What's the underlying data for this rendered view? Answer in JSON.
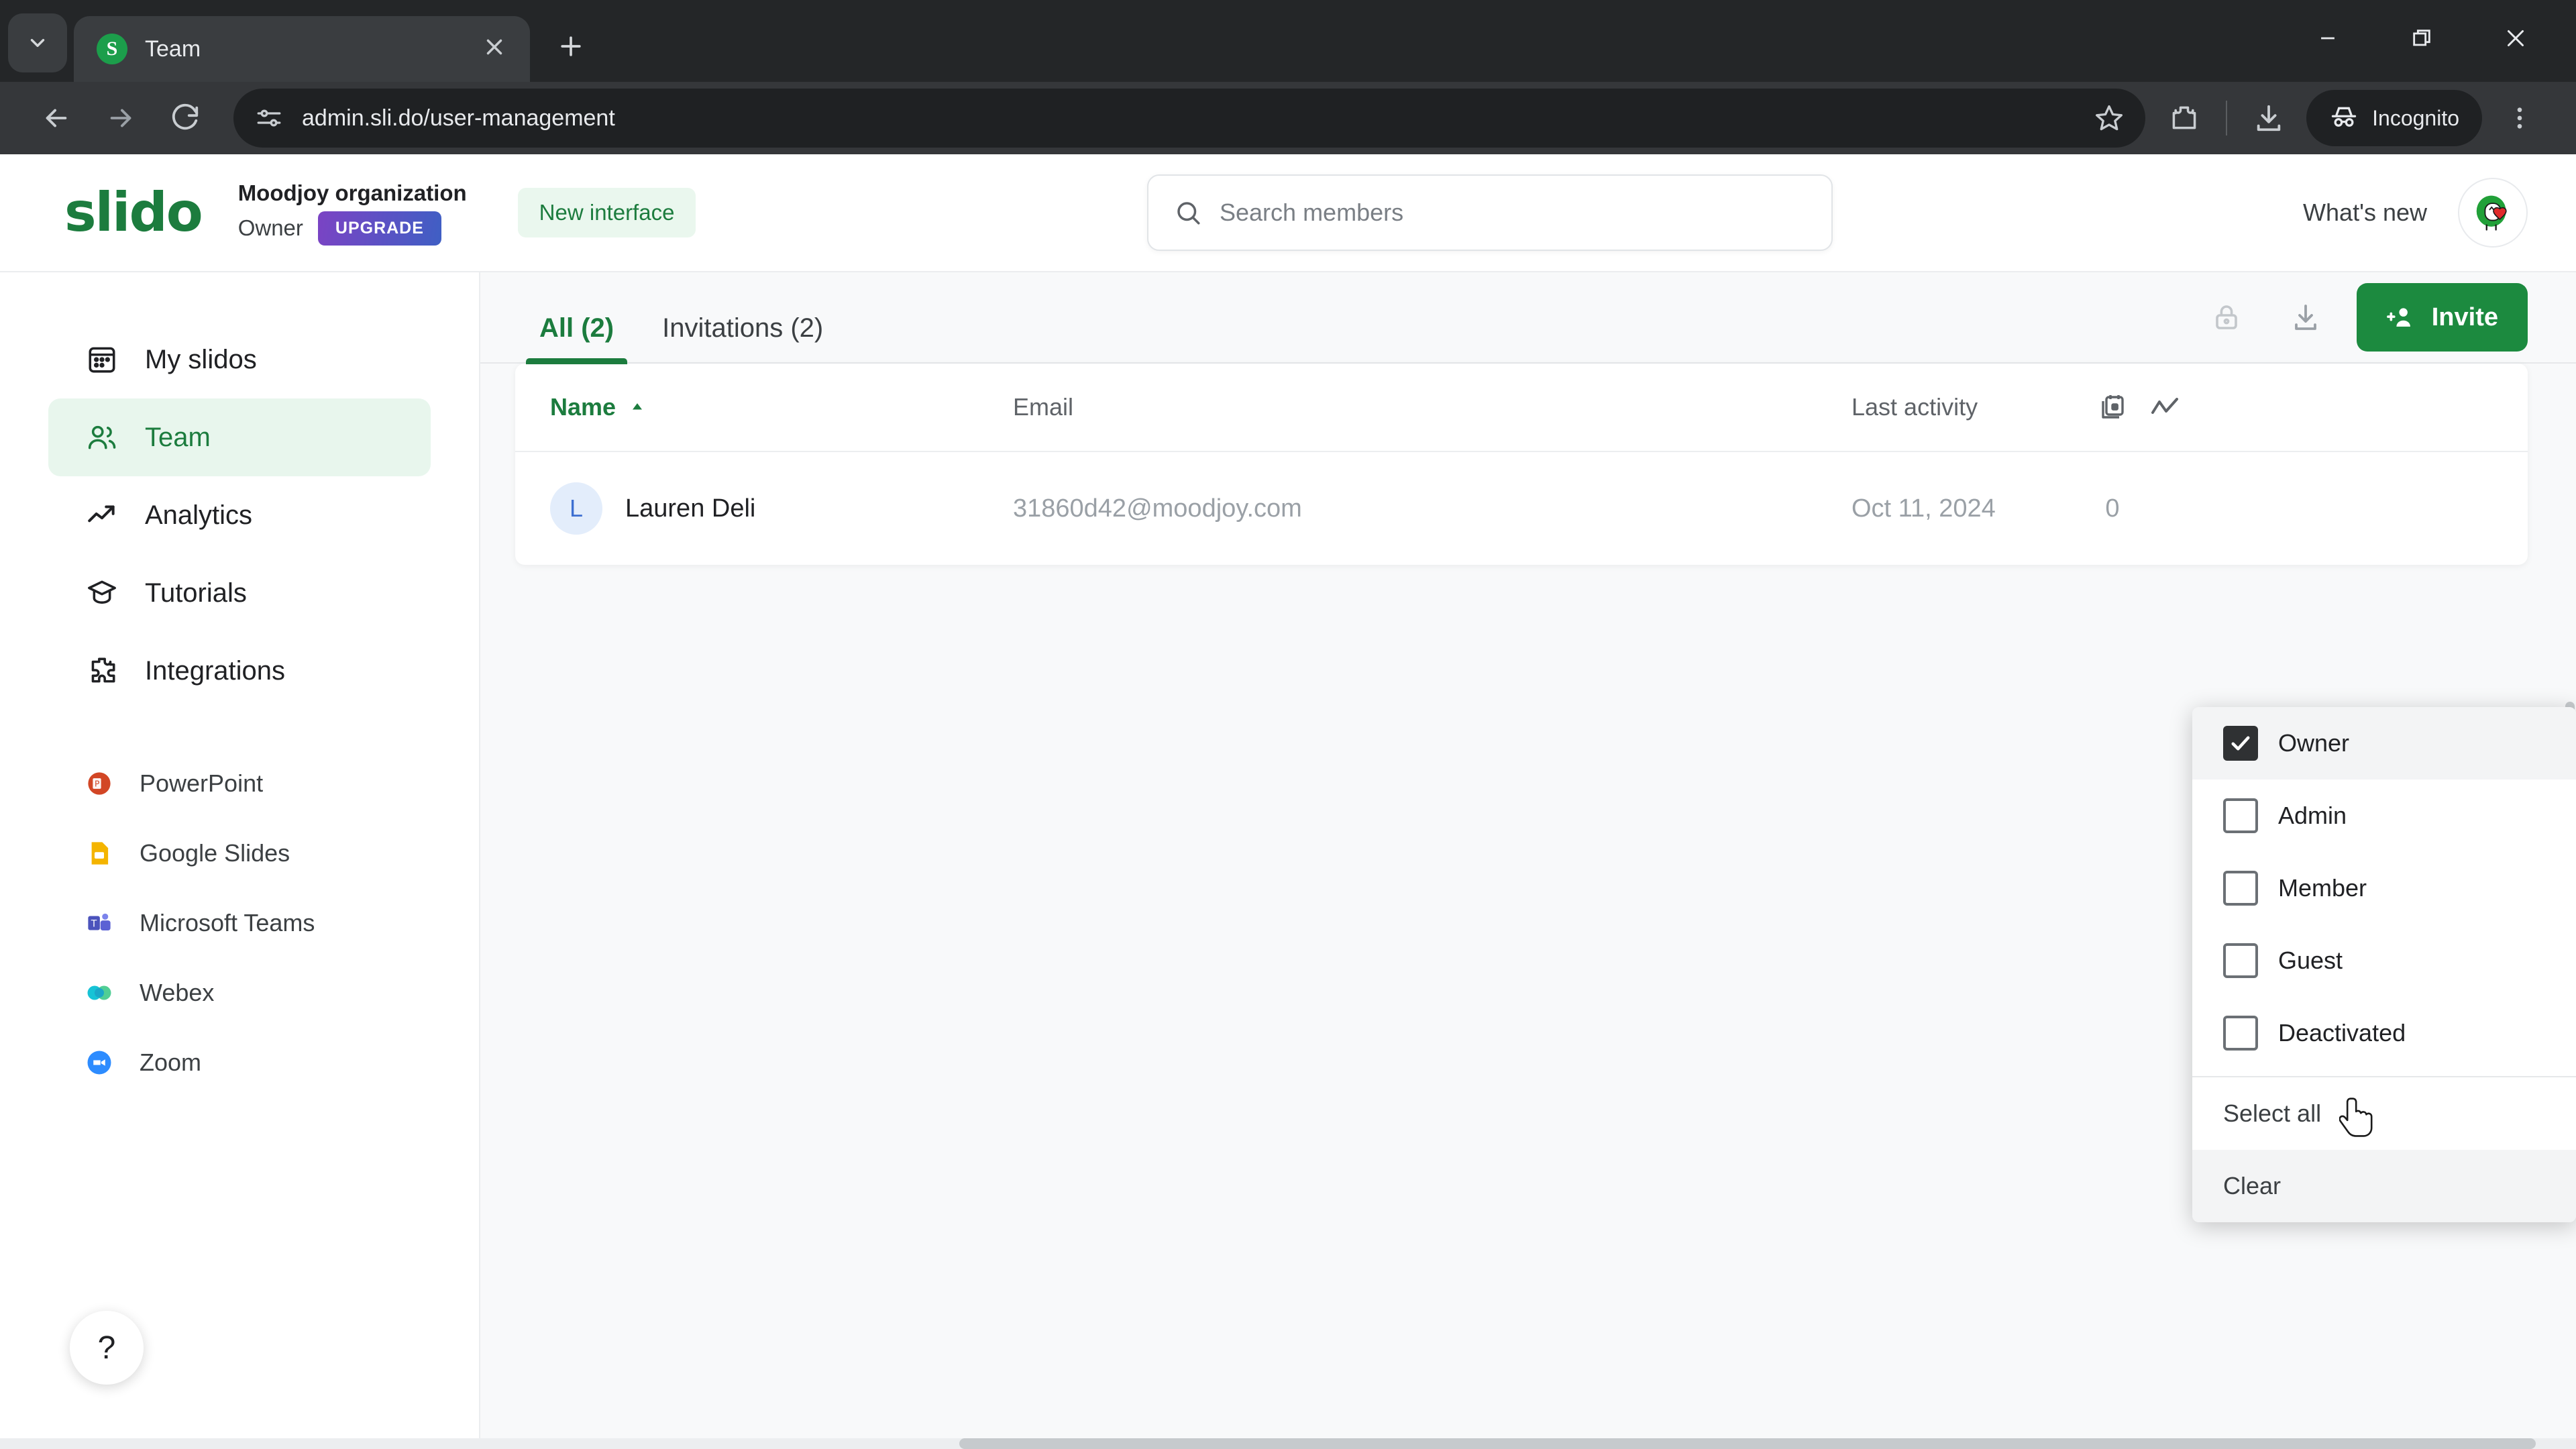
{
  "browser": {
    "tab": {
      "title": "Team",
      "favicon_letter": "S",
      "favicon_icon": "slido-favicon",
      "close_icon": "close-icon"
    },
    "tab_search_icon": "chevron-down-icon",
    "new_tab_icon": "plus-icon",
    "window": {
      "minimize_icon": "minimize-icon",
      "maximize_icon": "maximize-icon",
      "close_icon": "window-close-icon"
    },
    "nav": {
      "back_icon": "back-arrow-icon",
      "forward_icon": "forward-arrow-icon",
      "reload_icon": "reload-icon"
    },
    "omnibox": {
      "site_info_icon": "site-settings-icon",
      "url": "admin.sli.do/user-management",
      "bookmark_icon": "star-icon"
    },
    "actions": {
      "extensions_icon": "extensions-icon",
      "downloads_icon": "download-icon",
      "incognito_label": "Incognito",
      "incognito_icon": "incognito-icon",
      "menu_icon": "three-dot-menu-icon"
    }
  },
  "appheader": {
    "logo": "slido",
    "org_name": "Moodjoy organization",
    "org_role": "Owner",
    "upgrade_label": "UPGRADE",
    "new_interface_label": "New interface",
    "search": {
      "placeholder": "Search members",
      "value": "",
      "icon": "search-icon"
    },
    "whats_new_label": "What's new",
    "avatar_icon": "user-avatar-icon"
  },
  "sidebar": {
    "items": [
      {
        "label": "My slidos",
        "icon": "calendar-icon",
        "active": false
      },
      {
        "label": "Team",
        "icon": "people-icon",
        "active": true
      },
      {
        "label": "Analytics",
        "icon": "trend-up-icon",
        "active": false
      },
      {
        "label": "Tutorials",
        "icon": "graduation-cap-icon",
        "active": false
      },
      {
        "label": "Integrations",
        "icon": "puzzle-piece-icon",
        "active": false
      }
    ],
    "integrations": [
      {
        "label": "PowerPoint",
        "icon": "powerpoint-icon",
        "color": "#d24625"
      },
      {
        "label": "Google Slides",
        "icon": "google-slides-icon",
        "color": "#f4b400"
      },
      {
        "label": "Microsoft Teams",
        "icon": "microsoft-teams-icon",
        "color": "#4b53bc"
      },
      {
        "label": "Webex",
        "icon": "webex-icon",
        "color": "#17a2b8"
      },
      {
        "label": "Zoom",
        "icon": "zoom-icon",
        "color": "#2d8cff"
      }
    ],
    "help_label": "?",
    "help_icon": "help-question-icon"
  },
  "main": {
    "tabs": [
      {
        "label": "All (2)",
        "active": true
      },
      {
        "label": "Invitations (2)",
        "active": false
      }
    ],
    "toolbar": {
      "lock_icon": "lock-icon",
      "export_icon": "download-icon",
      "invite_label": "Invite",
      "invite_icon": "add-person-icon"
    },
    "table": {
      "columns": [
        {
          "label": "Name",
          "sort": "asc",
          "sort_icon": "sort-ascending-icon"
        },
        {
          "label": "Email"
        },
        {
          "label": "Last activity"
        },
        {
          "label": "",
          "icon": "event-calendar-icon"
        },
        {
          "label": "",
          "icon": "activity-trend-icon"
        }
      ],
      "rows": [
        {
          "initial": "L",
          "name": "Lauren Deli",
          "email": "31860d42@moodjoy.com",
          "last_activity": "Oct 11, 2024",
          "events": "0"
        }
      ]
    }
  },
  "dropdown": {
    "options": [
      {
        "label": "Owner",
        "checked": true,
        "hover": true
      },
      {
        "label": "Admin",
        "checked": false,
        "hover": false
      },
      {
        "label": "Member",
        "checked": false,
        "hover": false
      },
      {
        "label": "Guest",
        "checked": false,
        "hover": false
      },
      {
        "label": "Deactivated",
        "checked": false,
        "hover": false
      }
    ],
    "select_all_label": "Select all",
    "clear_label": "Clear"
  },
  "colors": {
    "brand_green": "#1c7c3e",
    "invite_green": "#1c8a3f",
    "upgrade_purple": "#7b43c4",
    "chrome_dark": "#35373a"
  }
}
